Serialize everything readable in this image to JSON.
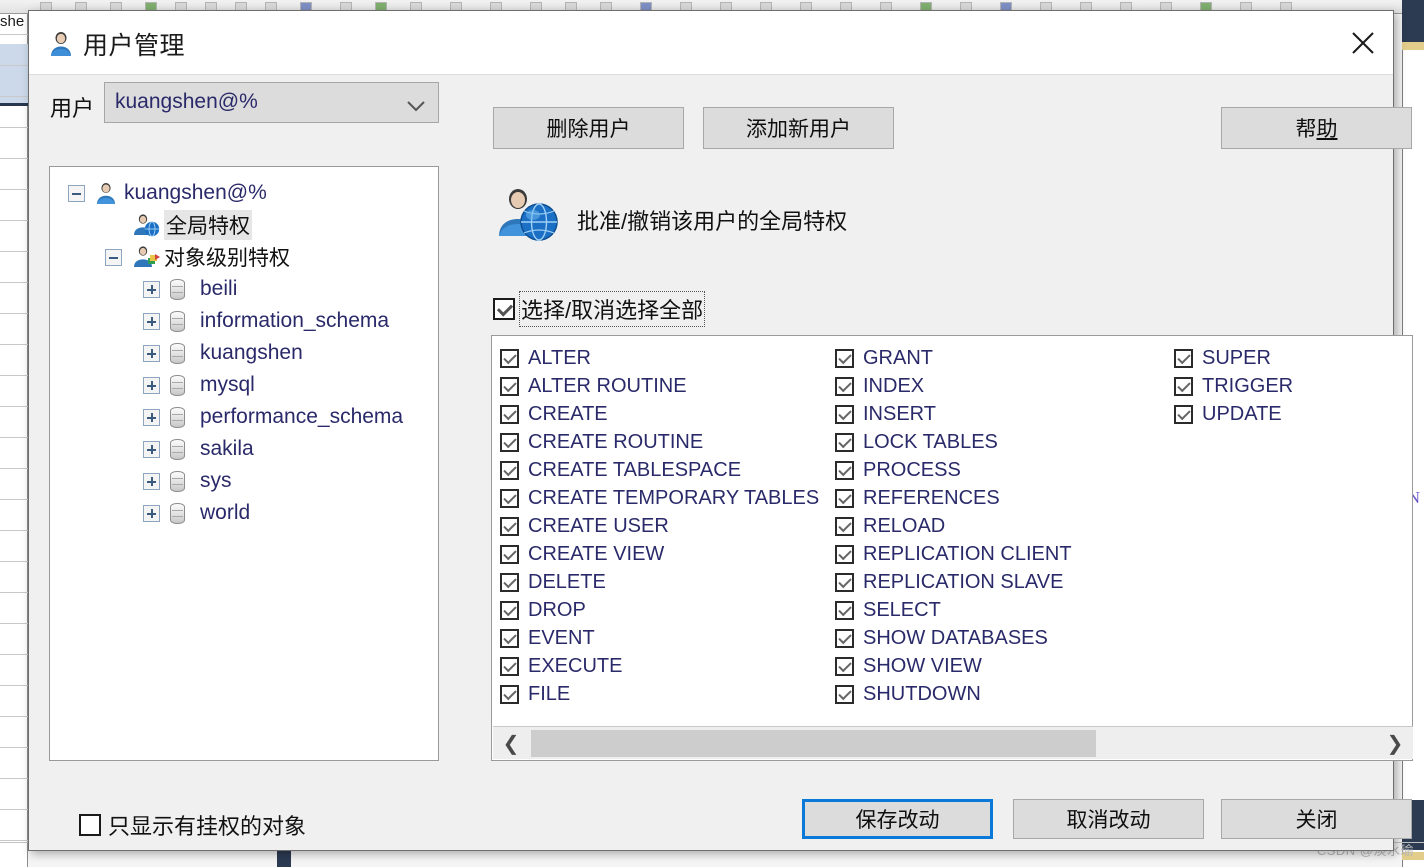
{
  "background": {
    "left_panel_text": "she",
    "right_marker": "N",
    "watermark": "CSDN @淡水瑜"
  },
  "dialog": {
    "title": "用户管理",
    "title_icon": "user-icon",
    "close_icon": "close-icon"
  },
  "user_row": {
    "label": "用户",
    "selected_user": "kuangshen@%",
    "dropdown_icon": "chevron-down-icon",
    "delete_user_button": "删除用户",
    "add_user_button": "添加新用户",
    "help_button_pre": "帮",
    "help_button_underlined": "助"
  },
  "tree": {
    "nodes": [
      {
        "label": "kuangshen@%",
        "icon": "user-icon",
        "toggle": "minus",
        "depth": 0,
        "type": "user",
        "selected": false
      },
      {
        "label": "全局特权",
        "icon": "user-globe-icon",
        "toggle": "none",
        "depth": 1,
        "type": "global",
        "selected": true
      },
      {
        "label": "对象级别特权",
        "icon": "user-objects-icon",
        "toggle": "minus",
        "depth": 1,
        "type": "object",
        "selected": false
      },
      {
        "label": "beili",
        "icon": "database-icon",
        "toggle": "plus",
        "depth": 2,
        "type": "schema",
        "selected": false
      },
      {
        "label": "information_schema",
        "icon": "database-icon",
        "toggle": "plus",
        "depth": 2,
        "type": "schema",
        "selected": false
      },
      {
        "label": "kuangshen",
        "icon": "database-icon",
        "toggle": "plus",
        "depth": 2,
        "type": "schema",
        "selected": false
      },
      {
        "label": "mysql",
        "icon": "database-icon",
        "toggle": "plus",
        "depth": 2,
        "type": "schema",
        "selected": false
      },
      {
        "label": "performance_schema",
        "icon": "database-icon",
        "toggle": "plus",
        "depth": 2,
        "type": "schema",
        "selected": false
      },
      {
        "label": "sakila",
        "icon": "database-icon",
        "toggle": "plus",
        "depth": 2,
        "type": "schema",
        "selected": false
      },
      {
        "label": "sys",
        "icon": "database-icon",
        "toggle": "plus",
        "depth": 2,
        "type": "schema",
        "selected": false
      },
      {
        "label": "world",
        "icon": "database-icon",
        "toggle": "plus",
        "depth": 2,
        "type": "schema",
        "selected": false
      }
    ]
  },
  "privileges_pane": {
    "header_icon": "user-globe-icon",
    "header_title": "批准/撤销该用户的全局特权",
    "select_all_label": "选择/取消选择全部",
    "select_all_checked": true,
    "columns": [
      [
        {
          "label": "ALTER",
          "checked": true
        },
        {
          "label": "ALTER ROUTINE",
          "checked": true
        },
        {
          "label": "CREATE",
          "checked": true
        },
        {
          "label": "CREATE ROUTINE",
          "checked": true
        },
        {
          "label": "CREATE TABLESPACE",
          "checked": true
        },
        {
          "label": "CREATE TEMPORARY TABLES",
          "checked": true
        },
        {
          "label": "CREATE USER",
          "checked": true
        },
        {
          "label": "CREATE VIEW",
          "checked": true
        },
        {
          "label": "DELETE",
          "checked": true
        },
        {
          "label": "DROP",
          "checked": true
        },
        {
          "label": "EVENT",
          "checked": true
        },
        {
          "label": "EXECUTE",
          "checked": true
        },
        {
          "label": "FILE",
          "checked": true
        }
      ],
      [
        {
          "label": "GRANT",
          "checked": true
        },
        {
          "label": "INDEX",
          "checked": true
        },
        {
          "label": "INSERT",
          "checked": true
        },
        {
          "label": "LOCK TABLES",
          "checked": true
        },
        {
          "label": "PROCESS",
          "checked": true
        },
        {
          "label": "REFERENCES",
          "checked": true
        },
        {
          "label": "RELOAD",
          "checked": true
        },
        {
          "label": "REPLICATION CLIENT",
          "checked": true
        },
        {
          "label": "REPLICATION SLAVE",
          "checked": true
        },
        {
          "label": "SELECT",
          "checked": true
        },
        {
          "label": "SHOW DATABASES",
          "checked": true
        },
        {
          "label": "SHOW VIEW",
          "checked": true
        },
        {
          "label": "SHUTDOWN",
          "checked": true
        }
      ],
      [
        {
          "label": "SUPER",
          "checked": true
        },
        {
          "label": "TRIGGER",
          "checked": true
        },
        {
          "label": "UPDATE",
          "checked": true
        }
      ]
    ],
    "scrollbar": {
      "left_arrow": "❮",
      "right_arrow": "❯"
    }
  },
  "footer": {
    "show_only_granted_label": "只显示有挂权的对象",
    "show_only_granted_checked": false,
    "save_button": "保存改动",
    "cancel_button": "取消改动",
    "close_button": "关闭"
  }
}
